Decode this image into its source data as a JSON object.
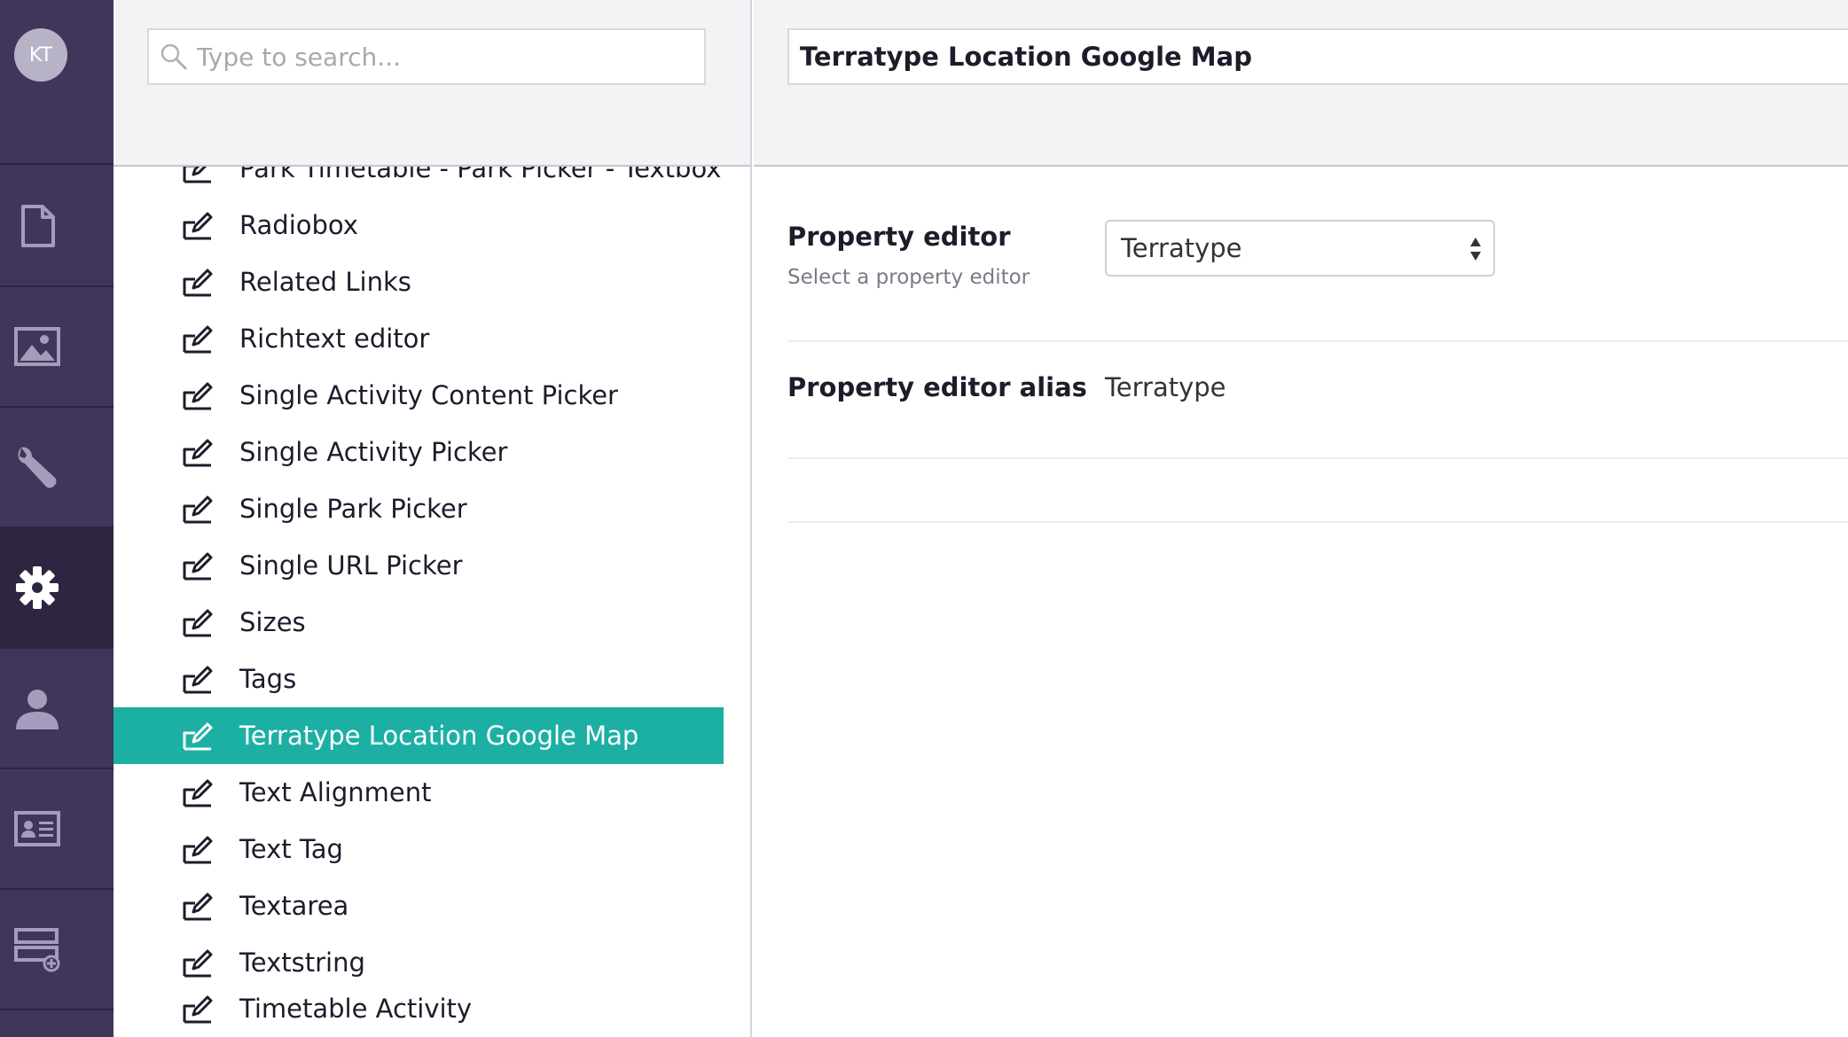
{
  "user": {
    "initials": "KT"
  },
  "nav": {
    "items": [
      {
        "name": "content",
        "icon": "document-icon"
      },
      {
        "name": "media",
        "icon": "image-icon"
      },
      {
        "name": "developer",
        "icon": "wrench-icon"
      },
      {
        "name": "settings",
        "icon": "gear-icon",
        "active": true
      },
      {
        "name": "users",
        "icon": "user-icon"
      },
      {
        "name": "members",
        "icon": "id-card-icon"
      },
      {
        "name": "forms",
        "icon": "form-add-icon"
      }
    ]
  },
  "tree": {
    "search_placeholder": "Type to search...",
    "items": [
      "Park Timetable - Park Picker - Textbox",
      "Radiobox",
      "Related Links",
      "Richtext editor",
      "Single Activity Content Picker",
      "Single Activity Picker",
      "Single Park Picker",
      "Single URL Picker",
      "Sizes",
      "Tags",
      "Terratype Location Google Map",
      "Text Alignment",
      "Text Tag",
      "Textarea",
      "Textstring",
      "Timetable Activity"
    ],
    "selected": "Terratype Location Google Map"
  },
  "editor": {
    "name": "Terratype Location Google Map",
    "property_editor": {
      "label": "Property editor",
      "description": "Select a property editor",
      "value": "Terratype"
    },
    "alias": {
      "label": "Property editor alias",
      "value": "Terratype"
    }
  },
  "colors": {
    "nav_bg": "#413659",
    "nav_active": "#2f2541",
    "selected_bg": "#1cb0a5"
  }
}
